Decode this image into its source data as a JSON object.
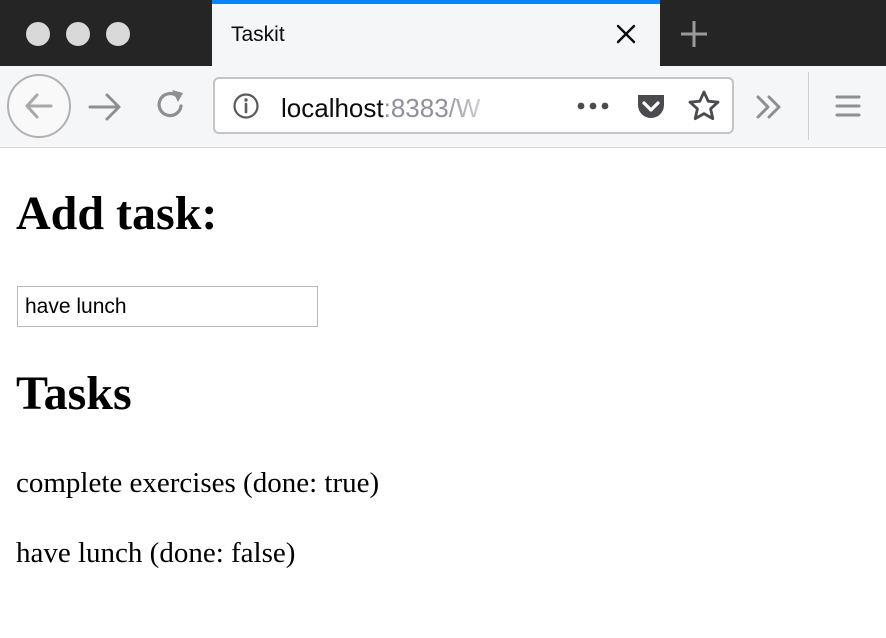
{
  "browser": {
    "tab": {
      "title": "Taskit"
    },
    "url": {
      "host": "localhost",
      "rest": ":8383/W"
    }
  },
  "page": {
    "add_heading": "Add task:",
    "input_value": "have lunch",
    "tasks_heading": "Tasks",
    "tasks": [
      {
        "text": "complete exercises (done: true)"
      },
      {
        "text": "have lunch (done: false)"
      }
    ]
  },
  "colors": {
    "tab_accent": "#0a84ff",
    "tabstrip_bg": "#252525",
    "toolbar_bg": "#f5f6f7"
  },
  "icons": {
    "traffic_lights": [
      "close-window-icon",
      "minimize-window-icon",
      "maximize-window-icon"
    ],
    "tab_close": "close-icon",
    "new_tab": "plus-icon",
    "back": "arrow-left-icon",
    "forward": "arrow-right-icon",
    "reload": "reload-icon",
    "site_info": "info-icon",
    "page_actions": "more-dots-icon",
    "pocket": "pocket-icon",
    "bookmark": "star-icon",
    "overflow": "double-chevron-icon",
    "menu": "hamburger-menu-icon"
  }
}
